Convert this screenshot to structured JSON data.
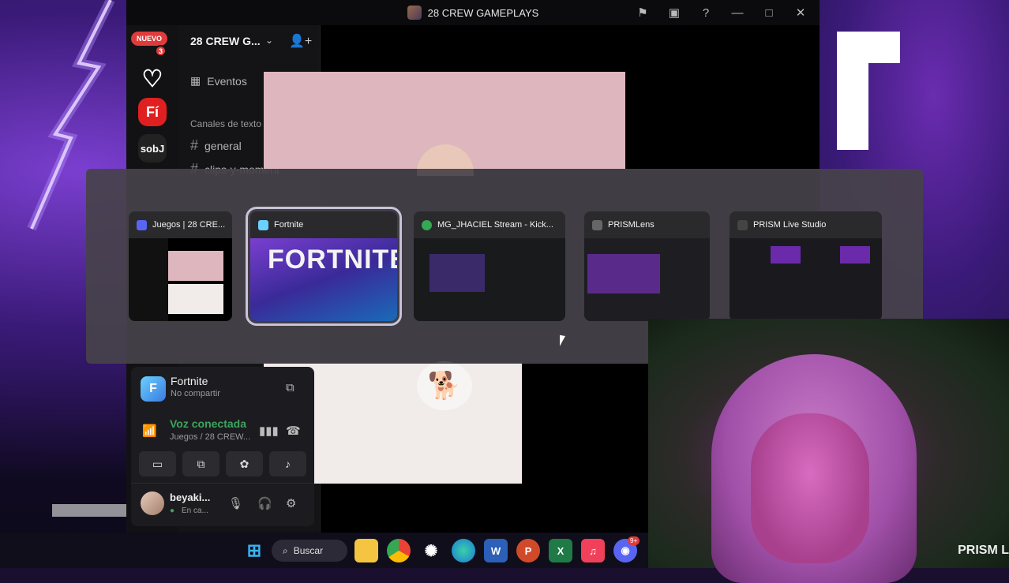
{
  "window": {
    "title": "28 CREW GAMEPLAYS",
    "controls": [
      "⚑",
      "▣",
      "?",
      "—",
      "□",
      "✕"
    ]
  },
  "servers": {
    "nuevo": "NUEVO",
    "nuevo_count": "3",
    "fi": "Fí",
    "sobj": "sobJ",
    "heart": "♡"
  },
  "channels": {
    "server_name": "28 CREW G...",
    "events": "Eventos",
    "category": "Canales de texto",
    "items": [
      {
        "name": "general"
      },
      {
        "name": "clips-y-moment"
      }
    ]
  },
  "switcher": {
    "windows": [
      {
        "title": "Juegos | 28 CRE...",
        "icon_color": "#5865f2"
      },
      {
        "title": "Fortnite",
        "icon_color": "#6ad0ff"
      },
      {
        "title": "MG_JHACIEL Stream - Kick...",
        "icon_color": "#34a853"
      },
      {
        "title": "PRISMLens",
        "icon_color": "#666666"
      },
      {
        "title": "PRISM Live Studio",
        "icon_color": "#444444"
      }
    ]
  },
  "panel": {
    "game": "Fortnite",
    "game_status": "No compartir",
    "voice": "Voz conectada",
    "voice_channel": "Juegos / 28 CREW...",
    "user": "beyaki...",
    "user_status": "En ca..."
  },
  "taskbar": {
    "search": "Buscar",
    "discord_badge": "9+"
  },
  "overlay": {
    "prism": "PRISM L"
  },
  "dog_emoji": "🐕"
}
